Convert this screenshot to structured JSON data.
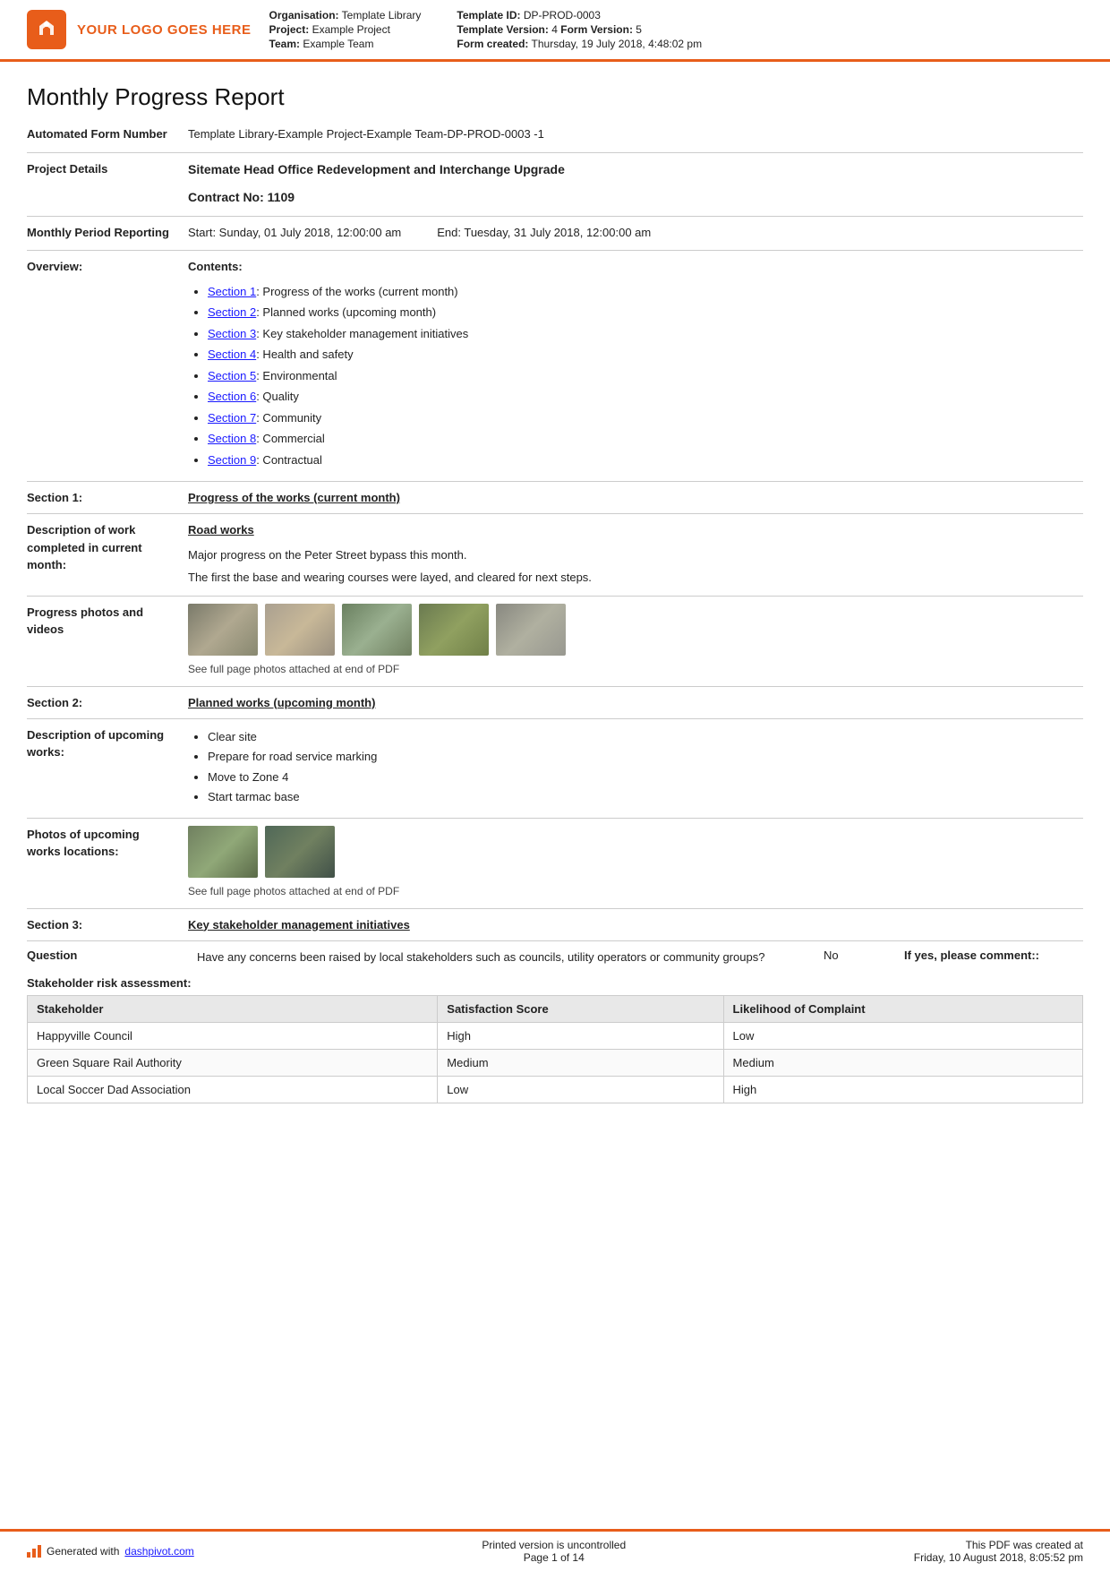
{
  "header": {
    "logo_text": "YOUR LOGO GOES HERE",
    "org_label": "Organisation:",
    "org_value": "Template Library",
    "project_label": "Project:",
    "project_value": "Example Project",
    "team_label": "Team:",
    "team_value": "Example Team",
    "template_id_label": "Template ID:",
    "template_id_value": "DP-PROD-0003",
    "template_version_label": "Template Version:",
    "template_version_value": "4",
    "form_version_label": "Form Version:",
    "form_version_value": "5",
    "form_created_label": "Form created:",
    "form_created_value": "Thursday, 19 July 2018, 4:48:02 pm"
  },
  "report": {
    "title": "Monthly Progress Report",
    "automated_form_number_label": "Automated Form Number",
    "automated_form_number_value": "Template Library-Example Project-Example Team-DP-PROD-0003   -1",
    "project_details_label": "Project Details",
    "project_details_value": "Sitemate Head Office Redevelopment and Interchange Upgrade",
    "contract_no_label": "Contract No:",
    "contract_no_value": "1109",
    "monthly_period_label": "Monthly Period Reporting",
    "period_start": "Start: Sunday, 01 July 2018, 12:00:00 am",
    "period_end": "End: Tuesday, 31 July 2018, 12:00:00 am",
    "overview_label": "Overview:",
    "contents_label": "Contents:"
  },
  "contents": [
    {
      "id": "1",
      "link_text": "Section 1",
      "desc": ": Progress of the works (current month)"
    },
    {
      "id": "2",
      "link_text": "Section 2",
      "desc": ": Planned works (upcoming month)"
    },
    {
      "id": "3",
      "link_text": "Section 3",
      "desc": ": Key stakeholder management initiatives"
    },
    {
      "id": "4",
      "link_text": "Section 4",
      "desc": ": Health and safety"
    },
    {
      "id": "5",
      "link_text": "Section 5",
      "desc": ": Environmental"
    },
    {
      "id": "6",
      "link_text": "Section 6",
      "desc": ": Quality"
    },
    {
      "id": "7",
      "link_text": "Section 7",
      "desc": ": Community"
    },
    {
      "id": "8",
      "link_text": "Section 8",
      "desc": ": Commercial"
    },
    {
      "id": "9",
      "link_text": "Section 9",
      "desc": ": Contractual"
    }
  ],
  "sections": {
    "section1": {
      "label": "Section 1:",
      "title": "Progress of the works (current month)",
      "desc_of_work_label": "Description of work completed in current month:",
      "work_title": "Road works",
      "work_desc1": "Major progress on the Peter Street bypass this month.",
      "work_desc2": "The first the base and wearing courses were layed, and cleared for next steps.",
      "photos_label": "Progress photos and videos",
      "photos_caption": "See full page photos attached at end of PDF"
    },
    "section2": {
      "label": "Section 2:",
      "title": "Planned works (upcoming month)",
      "desc_label": "Description of upcoming works:",
      "items": [
        "Clear site",
        "Prepare for road service marking",
        "Move to Zone 4",
        "Start tarmac base"
      ],
      "photos_label": "Photos of upcoming works locations:",
      "photos_caption": "See full page photos attached at end of PDF"
    },
    "section3": {
      "label": "Section 3:",
      "title": "Key stakeholder management initiatives",
      "question_label": "Question",
      "question_text": "Have any concerns been raised by local stakeholders such as councils, utility operators or community groups?",
      "question_answer": "No",
      "question_comment_label": "If yes, please comment::"
    }
  },
  "stakeholder": {
    "title": "Stakeholder risk assessment:",
    "columns": [
      "Stakeholder",
      "Satisfaction Score",
      "Likelihood of Complaint"
    ],
    "rows": [
      [
        "Happyville Council",
        "High",
        "Low"
      ],
      [
        "Green Square Rail Authority",
        "Medium",
        "Medium"
      ],
      [
        "Local Soccer Dad Association",
        "Low",
        "High"
      ]
    ]
  },
  "footer": {
    "generated_text": "Generated with ",
    "link_text": "dashpivot.com",
    "center_line1": "Printed version is uncontrolled",
    "center_line2": "Page 1 of 14",
    "right_line1": "This PDF was created at",
    "right_line2": "Friday, 10 August 2018, 8:05:52 pm"
  }
}
